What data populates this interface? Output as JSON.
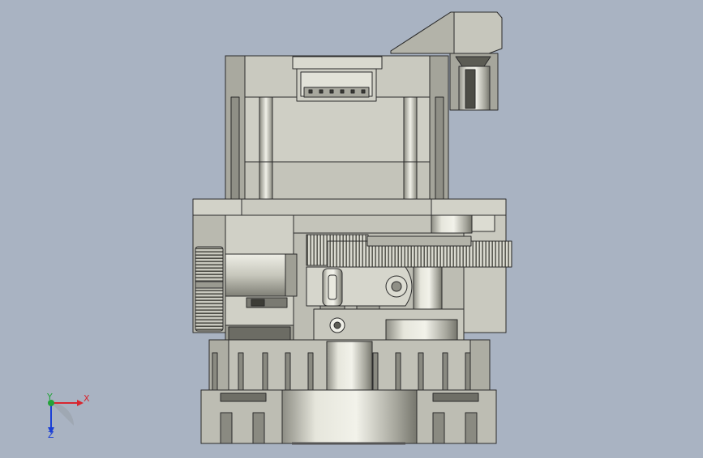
{
  "viewport": {
    "background": "#a9b3c2",
    "part_color_light": "#d6d6cc",
    "part_color_mid": "#b9b9ad",
    "part_color_dark": "#6f6f66",
    "edge_color": "#2b2b2b"
  },
  "triad": {
    "x_label": "X",
    "y_label": "Y",
    "z_label": "Z",
    "x_color": "#d8262f",
    "y_color": "#23a33a",
    "z_color": "#1a3fd6"
  }
}
